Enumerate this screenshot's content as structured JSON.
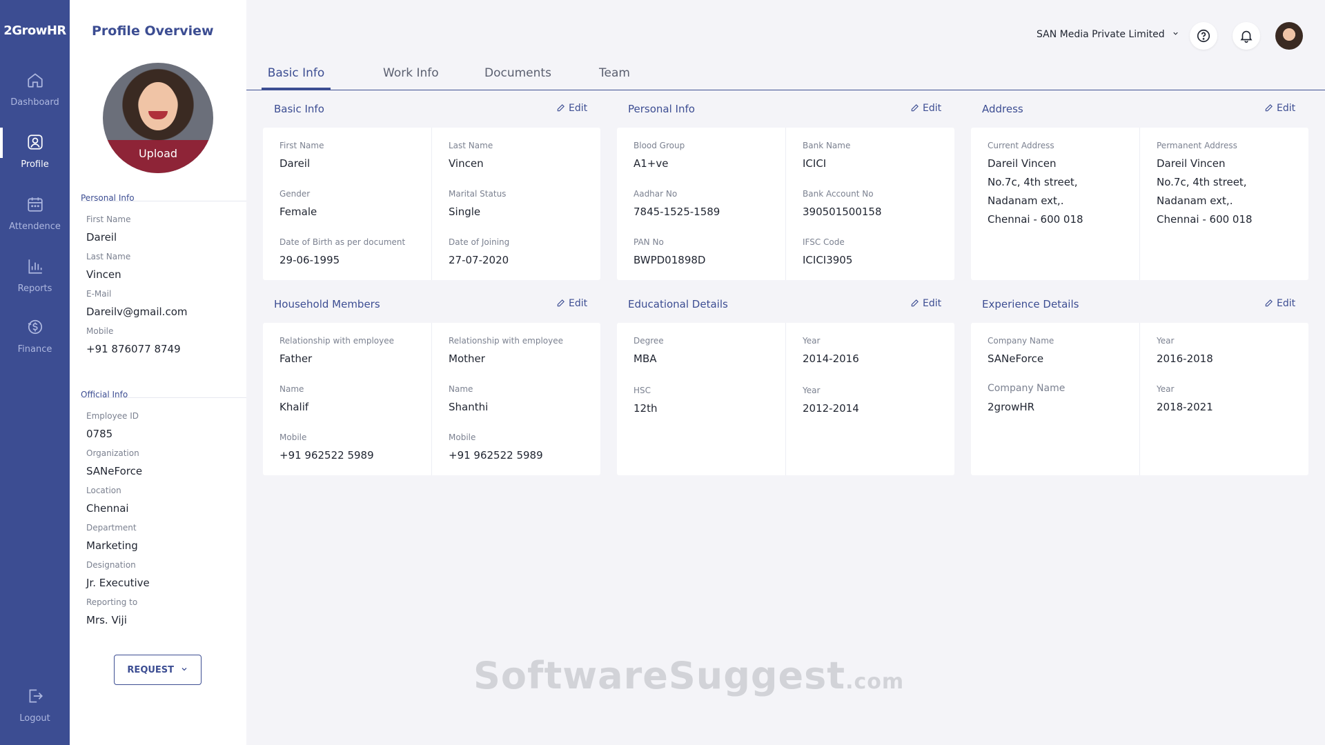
{
  "app": {
    "logo": "2GrowHR"
  },
  "nav": [
    {
      "label": "Dashboard",
      "icon": "home-icon"
    },
    {
      "label": "Profile",
      "icon": "profile-icon"
    },
    {
      "label": "Attendence",
      "icon": "calendar-icon"
    },
    {
      "label": "Reports",
      "icon": "chart-icon"
    },
    {
      "label": "Finance",
      "icon": "finance-icon"
    },
    {
      "label": "Logout",
      "icon": "logout-icon"
    }
  ],
  "profile": {
    "title": "Profile Overview",
    "upload_label": "Upload",
    "personal_section": "Personal Info",
    "personal": [
      {
        "label": "First Name",
        "value": "Dareil"
      },
      {
        "label": "Last Name",
        "value": "Vincen"
      },
      {
        "label": "E-Mail",
        "value": "Dareilv@gmail.com"
      },
      {
        "label": "Mobile",
        "value": "+91 876077 8749"
      }
    ],
    "official_section": "Official Info",
    "official": [
      {
        "label": "Employee ID",
        "value": "0785"
      },
      {
        "label": "Organization",
        "value": "SANeForce"
      },
      {
        "label": "Location",
        "value": "Chennai"
      },
      {
        "label": "Department",
        "value": "Marketing"
      },
      {
        "label": "Designation",
        "value": "Jr. Executive"
      },
      {
        "label": "Reporting to",
        "value": "Mrs. Viji"
      }
    ],
    "request_label": "REQUEST"
  },
  "topbar": {
    "company": "SAN Media Private Limited"
  },
  "tabs": [
    "Basic Info",
    "Work Info",
    "Documents",
    "Team"
  ],
  "edit_label": "Edit",
  "cards": {
    "basic": {
      "title": "Basic Info",
      "left": [
        {
          "label": "First Name",
          "value": "Dareil"
        },
        {
          "label": "Gender",
          "value": "Female"
        },
        {
          "label": "Date of Birth as per document",
          "value": "29-06-1995"
        }
      ],
      "right": [
        {
          "label": "Last Name",
          "value": "Vincen"
        },
        {
          "label": "Marital Status",
          "value": "Single"
        },
        {
          "label": "Date of Joining",
          "value": "27-07-2020"
        }
      ]
    },
    "personal": {
      "title": "Personal Info",
      "left": [
        {
          "label": "Blood Group",
          "value": "A1+ve"
        },
        {
          "label": "Aadhar No",
          "value": "7845-1525-1589"
        },
        {
          "label": "PAN No",
          "value": "BWPD01898D"
        }
      ],
      "right": [
        {
          "label": "Bank Name",
          "value": "ICICI"
        },
        {
          "label": "Bank Account No",
          "value": "390501500158"
        },
        {
          "label": "IFSC Code",
          "value": "ICICI3905"
        }
      ]
    },
    "address": {
      "title": "Address",
      "current_label": "Current Address",
      "current": [
        "Dareil Vincen",
        "No.7c, 4th street,",
        "Nadanam ext,.",
        "Chennai - 600 018"
      ],
      "permanent_label": "Permanent Address",
      "permanent": [
        "Dareil Vincen",
        "No.7c, 4th street,",
        "Nadanam ext,.",
        "Chennai - 600 018"
      ]
    },
    "household": {
      "title": "Household Members",
      "left": [
        {
          "label": "Relationship with employee",
          "value": "Father"
        },
        {
          "label": "Name",
          "value": "Khalif"
        },
        {
          "label": "Mobile",
          "value": "+91 962522 5989"
        }
      ],
      "right": [
        {
          "label": "Relationship with employee",
          "value": "Mother"
        },
        {
          "label": "Name",
          "value": "Shanthi"
        },
        {
          "label": "Mobile",
          "value": "+91 962522 5989"
        }
      ]
    },
    "education": {
      "title": "Educational Details",
      "left": [
        {
          "label": "Degree",
          "value": "MBA"
        },
        {
          "label": "HSC",
          "value": "12th"
        }
      ],
      "right": [
        {
          "label": "Year",
          "value": "2014-2016"
        },
        {
          "label": "Year",
          "value": "2012-2014"
        }
      ]
    },
    "experience": {
      "title": "Experience Details",
      "left": [
        {
          "label": "Company Name",
          "value": "SANeForce"
        },
        {
          "label": "Company Name",
          "value": "2growHR"
        }
      ],
      "right": [
        {
          "label": "Year",
          "value": "2016-2018"
        },
        {
          "label": "Year",
          "value": "2018-2021"
        }
      ]
    }
  },
  "watermark": {
    "main": "SoftwareSuggest",
    "suffix": ".com"
  }
}
